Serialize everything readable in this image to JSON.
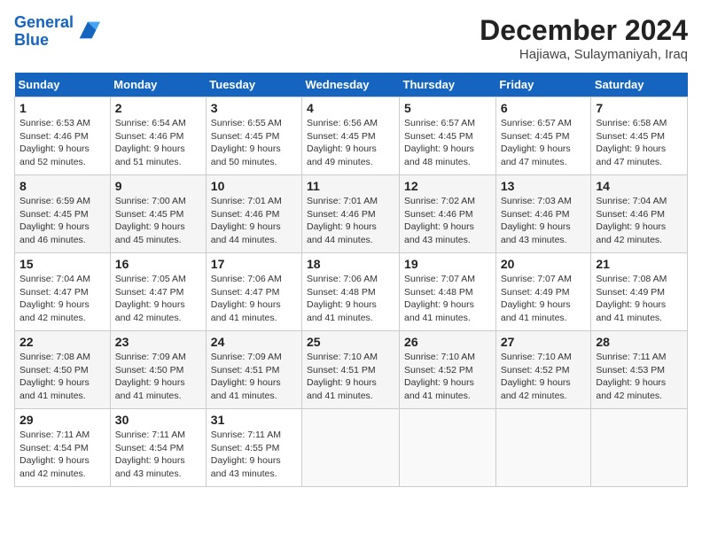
{
  "header": {
    "logo_line1": "General",
    "logo_line2": "Blue",
    "month": "December 2024",
    "location": "Hajiawa, Sulaymaniyah, Iraq"
  },
  "days_of_week": [
    "Sunday",
    "Monday",
    "Tuesday",
    "Wednesday",
    "Thursday",
    "Friday",
    "Saturday"
  ],
  "weeks": [
    [
      {
        "day": 1,
        "sunrise": "6:53 AM",
        "sunset": "4:46 PM",
        "daylight": "9 hours and 52 minutes."
      },
      {
        "day": 2,
        "sunrise": "6:54 AM",
        "sunset": "4:46 PM",
        "daylight": "9 hours and 51 minutes."
      },
      {
        "day": 3,
        "sunrise": "6:55 AM",
        "sunset": "4:45 PM",
        "daylight": "9 hours and 50 minutes."
      },
      {
        "day": 4,
        "sunrise": "6:56 AM",
        "sunset": "4:45 PM",
        "daylight": "9 hours and 49 minutes."
      },
      {
        "day": 5,
        "sunrise": "6:57 AM",
        "sunset": "4:45 PM",
        "daylight": "9 hours and 48 minutes."
      },
      {
        "day": 6,
        "sunrise": "6:57 AM",
        "sunset": "4:45 PM",
        "daylight": "9 hours and 47 minutes."
      },
      {
        "day": 7,
        "sunrise": "6:58 AM",
        "sunset": "4:45 PM",
        "daylight": "9 hours and 47 minutes."
      }
    ],
    [
      {
        "day": 8,
        "sunrise": "6:59 AM",
        "sunset": "4:45 PM",
        "daylight": "9 hours and 46 minutes."
      },
      {
        "day": 9,
        "sunrise": "7:00 AM",
        "sunset": "4:45 PM",
        "daylight": "9 hours and 45 minutes."
      },
      {
        "day": 10,
        "sunrise": "7:01 AM",
        "sunset": "4:46 PM",
        "daylight": "9 hours and 44 minutes."
      },
      {
        "day": 11,
        "sunrise": "7:01 AM",
        "sunset": "4:46 PM",
        "daylight": "9 hours and 44 minutes."
      },
      {
        "day": 12,
        "sunrise": "7:02 AM",
        "sunset": "4:46 PM",
        "daylight": "9 hours and 43 minutes."
      },
      {
        "day": 13,
        "sunrise": "7:03 AM",
        "sunset": "4:46 PM",
        "daylight": "9 hours and 43 minutes."
      },
      {
        "day": 14,
        "sunrise": "7:04 AM",
        "sunset": "4:46 PM",
        "daylight": "9 hours and 42 minutes."
      }
    ],
    [
      {
        "day": 15,
        "sunrise": "7:04 AM",
        "sunset": "4:47 PM",
        "daylight": "9 hours and 42 minutes."
      },
      {
        "day": 16,
        "sunrise": "7:05 AM",
        "sunset": "4:47 PM",
        "daylight": "9 hours and 42 minutes."
      },
      {
        "day": 17,
        "sunrise": "7:06 AM",
        "sunset": "4:47 PM",
        "daylight": "9 hours and 41 minutes."
      },
      {
        "day": 18,
        "sunrise": "7:06 AM",
        "sunset": "4:48 PM",
        "daylight": "9 hours and 41 minutes."
      },
      {
        "day": 19,
        "sunrise": "7:07 AM",
        "sunset": "4:48 PM",
        "daylight": "9 hours and 41 minutes."
      },
      {
        "day": 20,
        "sunrise": "7:07 AM",
        "sunset": "4:49 PM",
        "daylight": "9 hours and 41 minutes."
      },
      {
        "day": 21,
        "sunrise": "7:08 AM",
        "sunset": "4:49 PM",
        "daylight": "9 hours and 41 minutes."
      }
    ],
    [
      {
        "day": 22,
        "sunrise": "7:08 AM",
        "sunset": "4:50 PM",
        "daylight": "9 hours and 41 minutes."
      },
      {
        "day": 23,
        "sunrise": "7:09 AM",
        "sunset": "4:50 PM",
        "daylight": "9 hours and 41 minutes."
      },
      {
        "day": 24,
        "sunrise": "7:09 AM",
        "sunset": "4:51 PM",
        "daylight": "9 hours and 41 minutes."
      },
      {
        "day": 25,
        "sunrise": "7:10 AM",
        "sunset": "4:51 PM",
        "daylight": "9 hours and 41 minutes."
      },
      {
        "day": 26,
        "sunrise": "7:10 AM",
        "sunset": "4:52 PM",
        "daylight": "9 hours and 41 minutes."
      },
      {
        "day": 27,
        "sunrise": "7:10 AM",
        "sunset": "4:52 PM",
        "daylight": "9 hours and 42 minutes."
      },
      {
        "day": 28,
        "sunrise": "7:11 AM",
        "sunset": "4:53 PM",
        "daylight": "9 hours and 42 minutes."
      }
    ],
    [
      {
        "day": 29,
        "sunrise": "7:11 AM",
        "sunset": "4:54 PM",
        "daylight": "9 hours and 42 minutes."
      },
      {
        "day": 30,
        "sunrise": "7:11 AM",
        "sunset": "4:54 PM",
        "daylight": "9 hours and 43 minutes."
      },
      {
        "day": 31,
        "sunrise": "7:11 AM",
        "sunset": "4:55 PM",
        "daylight": "9 hours and 43 minutes."
      },
      null,
      null,
      null,
      null
    ]
  ]
}
